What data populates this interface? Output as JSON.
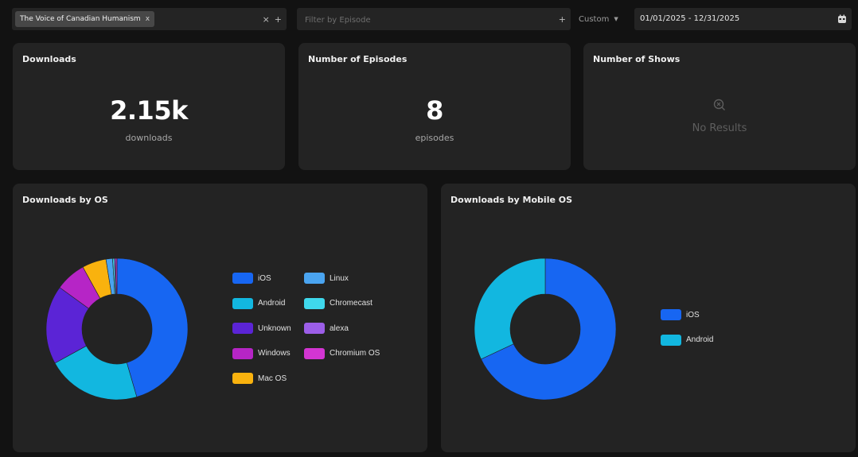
{
  "filters": {
    "show_chip": "The Voice of Canadian Humanism",
    "chip_close": "x",
    "clear_symbol": "×",
    "add_symbol": "+",
    "episode_placeholder": "Filter by Episode",
    "range_label": "Custom",
    "date_range": "01/01/2025 - 12/31/2025"
  },
  "cards": {
    "downloads": {
      "title": "Downloads",
      "value": "2.15k",
      "unit": "downloads"
    },
    "episodes": {
      "title": "Number of Episodes",
      "value": "8",
      "unit": "episodes"
    },
    "shows": {
      "title": "Number of Shows",
      "empty_text": "No Results"
    }
  },
  "chart_data": [
    {
      "type": "pie",
      "title": "Downloads by OS",
      "categories": [
        "iOS",
        "Android",
        "Unknown",
        "Windows",
        "Mac OS",
        "Linux",
        "Chromecast",
        "alexa",
        "Chromium OS"
      ],
      "values": [
        45.5,
        21.5,
        18.0,
        7.0,
        5.5,
        1.5,
        0.4,
        0.3,
        0.3
      ],
      "colors": [
        "#1766f2",
        "#12b7e0",
        "#5b24d6",
        "#b625c6",
        "#f9b20e",
        "#4aa4f0",
        "#3fd8ec",
        "#9c5ee8",
        "#d335d2"
      ],
      "legend": "right, two columns"
    },
    {
      "type": "pie",
      "title": "Downloads by Mobile OS",
      "categories": [
        "iOS",
        "Android"
      ],
      "values": [
        68,
        32
      ],
      "colors": [
        "#1766f2",
        "#12b7e0"
      ],
      "legend": "right"
    }
  ]
}
